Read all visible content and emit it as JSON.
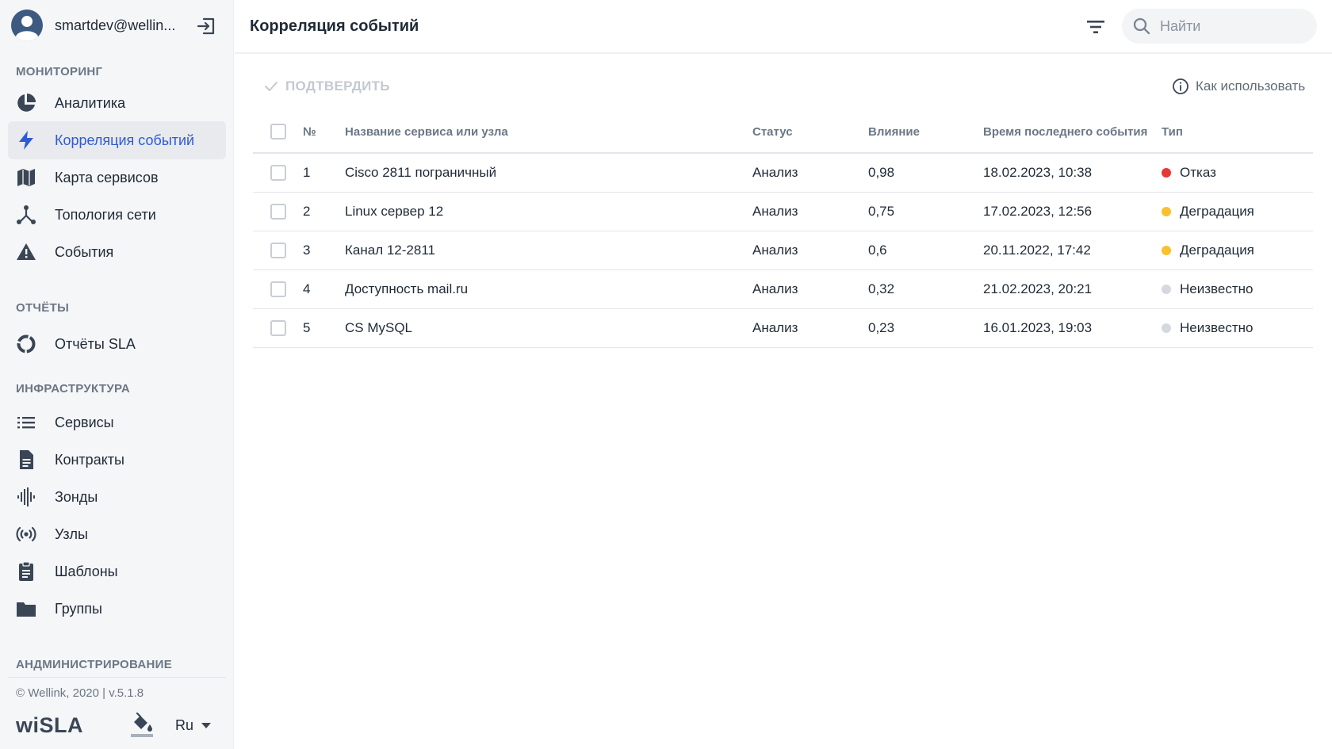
{
  "user": {
    "name": "smartdev@wellin..."
  },
  "sidebar": {
    "sections": [
      {
        "title": "МОНИТОРИНГ"
      },
      {
        "title": "ОТЧЁТЫ"
      },
      {
        "title": "ИНФРАСТРУКТУРА"
      },
      {
        "title": "АНДМИНИСТРИРОВАНИЕ"
      }
    ],
    "items": [
      {
        "label": "Аналитика",
        "icon": "pie-chart-icon"
      },
      {
        "label": "Корреляция событий",
        "icon": "bolt-icon",
        "active": true
      },
      {
        "label": "Карта сервисов",
        "icon": "map-icon"
      },
      {
        "label": "Топология сети",
        "icon": "network-topology-icon"
      },
      {
        "label": "События",
        "icon": "warning-icon"
      },
      {
        "label": "Отчёты SLA",
        "icon": "donut-icon"
      },
      {
        "label": "Сервисы",
        "icon": "list-icon"
      },
      {
        "label": "Контракты",
        "icon": "document-icon"
      },
      {
        "label": "Зонды",
        "icon": "waveform-icon"
      },
      {
        "label": "Узлы",
        "icon": "broadcast-icon"
      },
      {
        "label": "Шаблоны",
        "icon": "clipboard-icon"
      },
      {
        "label": "Группы",
        "icon": "folder-icon"
      }
    ],
    "footer": {
      "copyright": "© Wellink, 2020 | v.5.1.8",
      "logo": "wiSLA",
      "language": "Ru"
    }
  },
  "header": {
    "title": "Корреляция событий",
    "search_placeholder": "Найти"
  },
  "toolbar": {
    "confirm_label": "ПОДТВЕРДИТЬ",
    "howto_label": "Как использовать"
  },
  "table": {
    "columns": [
      "№",
      "Название сервиса или узла",
      "Статус",
      "Влияние",
      "Время последнего события",
      "Тип"
    ],
    "rows": [
      {
        "num": "1",
        "name": "Cisco 2811 пограничный",
        "status": "Анализ",
        "impact": "0,98",
        "time": "18.02.2023, 10:38",
        "type": "Отказ",
        "type_color": "#e53935"
      },
      {
        "num": "2",
        "name": "Linux сервер 12",
        "status": "Анализ",
        "impact": "0,75",
        "time": "17.02.2023, 12:56",
        "type": "Деградация",
        "type_color": "#fbc02d"
      },
      {
        "num": "3",
        "name": "Канал 12-2811",
        "status": "Анализ",
        "impact": "0,6",
        "time": "20.11.2022, 17:42",
        "type": "Деградация",
        "type_color": "#fbc02d"
      },
      {
        "num": "4",
        "name": "Доступность mail.ru",
        "status": "Анализ",
        "impact": "0,32",
        "time": "21.02.2023, 20:21",
        "type": "Неизвестно",
        "type_color": "#d5d8dc"
      },
      {
        "num": "5",
        "name": "CS MySQL",
        "status": "Анализ",
        "impact": "0,23",
        "time": "16.01.2023, 19:03",
        "type": "Неизвестно",
        "type_color": "#d5d8dc"
      }
    ]
  },
  "colors": {
    "accent": "#2d5bd6",
    "icon": "#3a4656",
    "sidebar_bg": "#f5f6f8"
  }
}
